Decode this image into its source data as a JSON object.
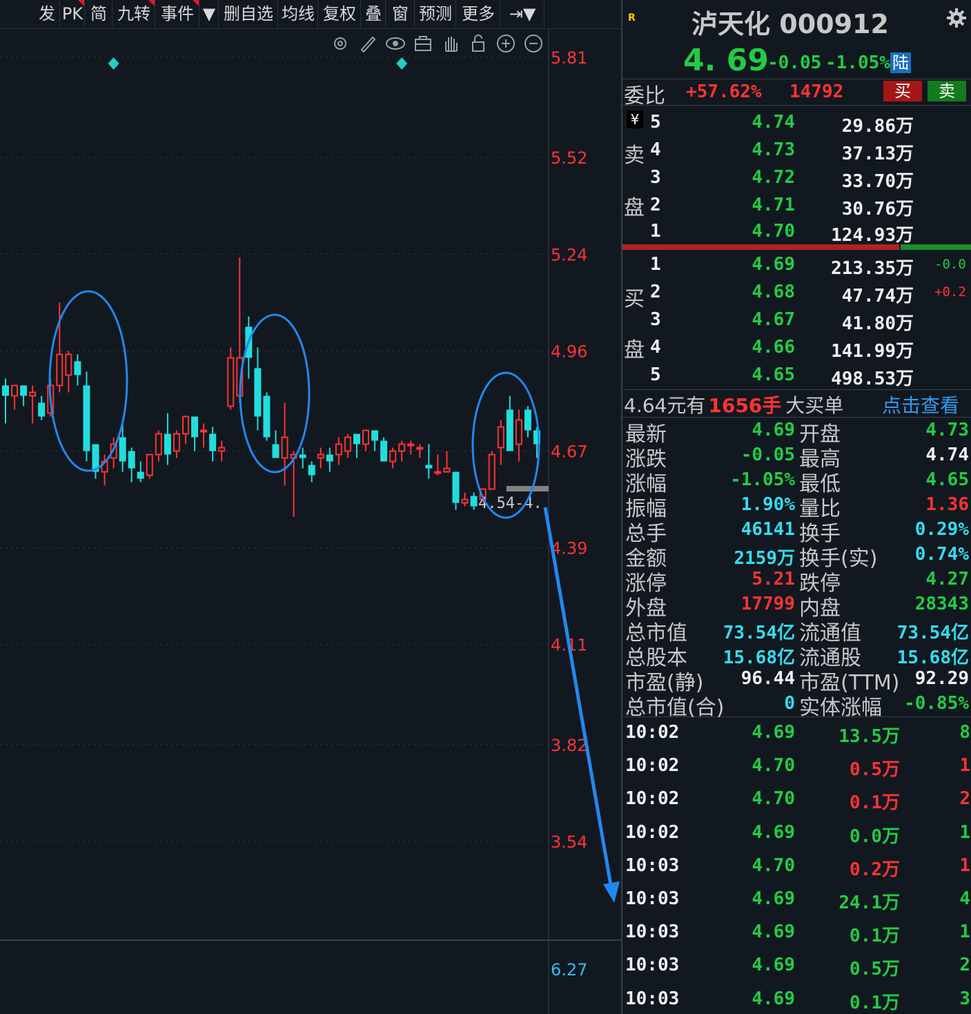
{
  "toolbar": {
    "items": [
      {
        "label": "发",
        "flag": false
      },
      {
        "label": "PK",
        "flag": true
      },
      {
        "label": "简",
        "flag": false
      },
      {
        "label": "九转",
        "flag": true
      },
      {
        "label": "事件",
        "flag": true
      },
      {
        "label": "▼",
        "flag": false
      },
      {
        "label": "删自选",
        "flag": false
      },
      {
        "label": "均线",
        "flag": false
      },
      {
        "label": "复权",
        "flag": false
      },
      {
        "label": "叠",
        "flag": false
      },
      {
        "label": "窗",
        "flag": false
      },
      {
        "label": "预测",
        "flag": false
      },
      {
        "label": "更多",
        "flag": false
      },
      {
        "label": "⇥▼",
        "flag": false
      }
    ],
    "tool_icons": [
      "gear-icon",
      "pen-icon",
      "eye-icon",
      "toolbox-icon",
      "hand-icon",
      "lock-icon",
      "zoom-in-icon",
      "zoom-out-icon"
    ]
  },
  "chart_data": {
    "type": "candlestick",
    "price_axis": {
      "ticks": [
        "5.81",
        "5.52",
        "5.24",
        "4.96",
        "4.67",
        "4.39",
        "4.11",
        "3.82",
        "3.54"
      ],
      "min": 3.54,
      "max": 5.81
    },
    "lower_axis_tick": "6.27",
    "price_line_label": "4.54-4.",
    "candles": [
      {
        "o": 4.86,
        "h": 4.88,
        "l": 4.75,
        "c": 4.83
      },
      {
        "o": 4.83,
        "h": 4.86,
        "l": 4.79,
        "c": 4.86
      },
      {
        "o": 4.86,
        "h": 4.86,
        "l": 4.8,
        "c": 4.83
      },
      {
        "o": 4.83,
        "h": 4.86,
        "l": 4.75,
        "c": 4.84
      },
      {
        "o": 4.81,
        "h": 4.83,
        "l": 4.76,
        "c": 4.77
      },
      {
        "o": 4.78,
        "h": 4.88,
        "l": 4.77,
        "c": 4.86
      },
      {
        "o": 4.86,
        "h": 5.1,
        "l": 4.84,
        "c": 4.95
      },
      {
        "o": 4.89,
        "h": 4.96,
        "l": 4.84,
        "c": 4.95
      },
      {
        "o": 4.93,
        "h": 4.95,
        "l": 4.86,
        "c": 4.89
      },
      {
        "o": 4.86,
        "h": 4.9,
        "l": 4.64,
        "c": 4.67
      },
      {
        "o": 4.69,
        "h": 4.69,
        "l": 4.59,
        "c": 4.61
      },
      {
        "o": 4.61,
        "h": 4.66,
        "l": 4.57,
        "c": 4.64
      },
      {
        "o": 4.65,
        "h": 4.71,
        "l": 4.62,
        "c": 4.69
      },
      {
        "o": 4.71,
        "h": 4.76,
        "l": 4.61,
        "c": 4.64
      },
      {
        "o": 4.67,
        "h": 4.68,
        "l": 4.58,
        "c": 4.62
      },
      {
        "o": 4.61,
        "h": 4.64,
        "l": 4.58,
        "c": 4.59
      },
      {
        "o": 4.6,
        "h": 4.66,
        "l": 4.59,
        "c": 4.66
      },
      {
        "o": 4.66,
        "h": 4.73,
        "l": 4.64,
        "c": 4.72
      },
      {
        "o": 4.72,
        "h": 4.78,
        "l": 4.63,
        "c": 4.66
      },
      {
        "o": 4.67,
        "h": 4.73,
        "l": 4.65,
        "c": 4.72
      },
      {
        "o": 4.72,
        "h": 4.77,
        "l": 4.69,
        "c": 4.77
      },
      {
        "o": 4.77,
        "h": 4.77,
        "l": 4.67,
        "c": 4.71
      },
      {
        "o": 4.73,
        "h": 4.75,
        "l": 4.68,
        "c": 4.73
      },
      {
        "o": 4.72,
        "h": 4.74,
        "l": 4.64,
        "c": 4.67
      },
      {
        "o": 4.67,
        "h": 4.7,
        "l": 4.64,
        "c": 4.68
      },
      {
        "o": 4.8,
        "h": 4.97,
        "l": 4.79,
        "c": 4.94
      },
      {
        "o": 4.83,
        "h": 5.23,
        "l": 4.81,
        "c": 4.94
      },
      {
        "o": 5.03,
        "h": 5.06,
        "l": 4.88,
        "c": 4.94
      },
      {
        "o": 4.91,
        "h": 4.97,
        "l": 4.73,
        "c": 4.77
      },
      {
        "o": 4.83,
        "h": 4.84,
        "l": 4.7,
        "c": 4.71
      },
      {
        "o": 4.69,
        "h": 4.73,
        "l": 4.65,
        "c": 4.65
      },
      {
        "o": 4.65,
        "h": 4.81,
        "l": 4.57,
        "c": 4.71
      },
      {
        "o": 4.65,
        "h": 4.67,
        "l": 4.48,
        "c": 4.66
      },
      {
        "o": 4.66,
        "h": 4.68,
        "l": 4.62,
        "c": 4.65
      },
      {
        "o": 4.63,
        "h": 4.64,
        "l": 4.58,
        "c": 4.6
      },
      {
        "o": 4.65,
        "h": 4.68,
        "l": 4.62,
        "c": 4.66
      },
      {
        "o": 4.66,
        "h": 4.68,
        "l": 4.61,
        "c": 4.64
      },
      {
        "o": 4.66,
        "h": 4.71,
        "l": 4.63,
        "c": 4.69
      },
      {
        "o": 4.67,
        "h": 4.72,
        "l": 4.65,
        "c": 4.71
      },
      {
        "o": 4.72,
        "h": 4.72,
        "l": 4.65,
        "c": 4.69
      },
      {
        "o": 4.69,
        "h": 4.73,
        "l": 4.67,
        "c": 4.73
      },
      {
        "o": 4.73,
        "h": 4.73,
        "l": 4.67,
        "c": 4.7
      },
      {
        "o": 4.7,
        "h": 4.71,
        "l": 4.64,
        "c": 4.64
      },
      {
        "o": 4.64,
        "h": 4.68,
        "l": 4.62,
        "c": 4.67
      },
      {
        "o": 4.67,
        "h": 4.7,
        "l": 4.64,
        "c": 4.69
      },
      {
        "o": 4.69,
        "h": 4.7,
        "l": 4.66,
        "c": 4.69
      },
      {
        "o": 4.68,
        "h": 4.69,
        "l": 4.65,
        "c": 4.68
      },
      {
        "o": 4.63,
        "h": 4.69,
        "l": 4.59,
        "c": 4.62
      },
      {
        "o": 4.61,
        "h": 4.66,
        "l": 4.6,
        "c": 4.61
      },
      {
        "o": 4.61,
        "h": 4.67,
        "l": 4.61,
        "c": 4.62
      },
      {
        "o": 4.61,
        "h": 4.61,
        "l": 4.5,
        "c": 4.52
      },
      {
        "o": 4.52,
        "h": 4.55,
        "l": 4.51,
        "c": 4.53
      },
      {
        "o": 4.54,
        "h": 4.55,
        "l": 4.5,
        "c": 4.51
      },
      {
        "o": 4.53,
        "h": 4.56,
        "l": 4.52,
        "c": 4.56
      },
      {
        "o": 4.56,
        "h": 4.67,
        "l": 4.56,
        "c": 4.66
      },
      {
        "o": 4.68,
        "h": 4.76,
        "l": 4.63,
        "c": 4.74
      },
      {
        "o": 4.79,
        "h": 4.83,
        "l": 4.67,
        "c": 4.67
      },
      {
        "o": 4.69,
        "h": 4.79,
        "l": 4.64,
        "c": 4.76
      },
      {
        "o": 4.79,
        "h": 4.8,
        "l": 4.71,
        "c": 4.73
      },
      {
        "o": 4.73,
        "h": 4.74,
        "l": 4.65,
        "c": 4.69
      }
    ],
    "markers": [
      {
        "index": 12
      },
      {
        "index": 44
      }
    ]
  },
  "stock": {
    "name": "泸天化",
    "code": "000912",
    "market_badge": "R",
    "price": "4. 69",
    "change": "-0.05",
    "change_pct": "-1.05%",
    "exchange_badge": "陆"
  },
  "weibi": {
    "label": "委比",
    "pct": "+57.62%",
    "diff": "14792",
    "buy_btn": "买",
    "sell_btn": "卖"
  },
  "asks": {
    "side_label_1": "卖",
    "side_label_2": "盘",
    "yen_badge": "¥",
    "rows": [
      {
        "level": "5",
        "price": "4.74",
        "vol": "29.86万"
      },
      {
        "level": "4",
        "price": "4.73",
        "vol": "37.13万"
      },
      {
        "level": "3",
        "price": "4.72",
        "vol": "33.70万"
      },
      {
        "level": "2",
        "price": "4.71",
        "vol": "30.76万"
      },
      {
        "level": "1",
        "price": "4.70",
        "vol": "124.93万"
      }
    ]
  },
  "ratio_bar": {
    "buy_fraction": 0.79
  },
  "bids": {
    "side_label_1": "买",
    "side_label_2": "盘",
    "rows": [
      {
        "level": "1",
        "price": "4.69",
        "vol": "213.35万",
        "delta": "-0.0"
      },
      {
        "level": "2",
        "price": "4.68",
        "vol": "47.74万",
        "delta": "+0.2"
      },
      {
        "level": "3",
        "price": "4.67",
        "vol": "41.80万",
        "delta": ""
      },
      {
        "level": "4",
        "price": "4.66",
        "vol": "141.99万",
        "delta": ""
      },
      {
        "level": "5",
        "price": "4.65",
        "vol": "498.53万",
        "delta": ""
      }
    ]
  },
  "big_order": {
    "price_text": "4.64元有",
    "qty": "1656手",
    "suffix": "大买单",
    "link": "点击查看"
  },
  "stats": [
    {
      "l1": "最新",
      "v1": "4.69",
      "c1": "green",
      "l2": "开盘",
      "v2": "4.73",
      "c2": "green"
    },
    {
      "l1": "涨跌",
      "v1": "-0.05",
      "c1": "green",
      "l2": "最高",
      "v2": "4.74",
      "c2": "white"
    },
    {
      "l1": "涨幅",
      "v1": "-1.05%",
      "c1": "green",
      "l2": "最低",
      "v2": "4.65",
      "c2": "green"
    },
    {
      "l1": "振幅",
      "v1": "1.90%",
      "c1": "cyan",
      "l2": "量比",
      "v2": "1.36",
      "c2": "red"
    },
    {
      "l1": "总手",
      "v1": "46141",
      "c1": "cyan",
      "l2": "换手",
      "v2": "0.29%",
      "c2": "cyan"
    },
    {
      "l1": "金额",
      "v1": "2159万",
      "c1": "cyan",
      "l2": "换手(实)",
      "v2": "0.74%",
      "c2": "cyan"
    },
    {
      "l1": "涨停",
      "v1": "5.21",
      "c1": "red",
      "l2": "跌停",
      "v2": "4.27",
      "c2": "green"
    },
    {
      "l1": "外盘",
      "v1": "17799",
      "c1": "red",
      "l2": "内盘",
      "v2": "28343",
      "c2": "green"
    },
    {
      "l1": "总市值",
      "v1": "73.54亿",
      "c1": "cyan",
      "l2": "流通值",
      "v2": "73.54亿",
      "c2": "cyan"
    },
    {
      "l1": "总股本",
      "v1": "15.68亿",
      "c1": "cyan",
      "l2": "流通股",
      "v2": "15.68亿",
      "c2": "cyan"
    },
    {
      "l1": "市盈(静)",
      "v1": "96.44",
      "c1": "white",
      "l2": "市盈(TTM)",
      "v2": "92.29",
      "c2": "white"
    },
    {
      "l1": "总市值(合)",
      "v1": "0",
      "c1": "cyan",
      "l2": "实体涨幅",
      "v2": "-0.85%",
      "c2": "green"
    }
  ],
  "ticks": [
    {
      "time": "10:02",
      "price": "4.69",
      "vol": "13.5万",
      "n": "8",
      "vc": "green",
      "pc": "green"
    },
    {
      "time": "10:02",
      "price": "4.70",
      "vol": "0.5万",
      "n": "1",
      "vc": "red",
      "pc": "green"
    },
    {
      "time": "10:02",
      "price": "4.70",
      "vol": "0.1万",
      "n": "2",
      "vc": "red",
      "pc": "green"
    },
    {
      "time": "10:02",
      "price": "4.69",
      "vol": "0.0万",
      "n": "1",
      "vc": "green",
      "pc": "green"
    },
    {
      "time": "10:03",
      "price": "4.70",
      "vol": "0.2万",
      "n": "1",
      "vc": "red",
      "pc": "green"
    },
    {
      "time": "10:03",
      "price": "4.69",
      "vol": "24.1万",
      "n": "4",
      "vc": "green",
      "pc": "green"
    },
    {
      "time": "10:03",
      "price": "4.69",
      "vol": "0.1万",
      "n": "1",
      "vc": "green",
      "pc": "green"
    },
    {
      "time": "10:03",
      "price": "4.69",
      "vol": "0.5万",
      "n": "2",
      "vc": "green",
      "pc": "green"
    },
    {
      "time": "10:03",
      "price": "4.69",
      "vol": "0.1万",
      "n": "3",
      "vc": "green",
      "pc": "green"
    }
  ],
  "colors": {
    "up": "#ff3333",
    "down": "#22dddd",
    "axis_label": "#ff3333",
    "lower_axis_label": "#33bbee",
    "annotation": "#2288ee",
    "green": "#22cc44",
    "red": "#ff3333",
    "cyan": "#33ddee",
    "white": "#f0f0f0"
  }
}
